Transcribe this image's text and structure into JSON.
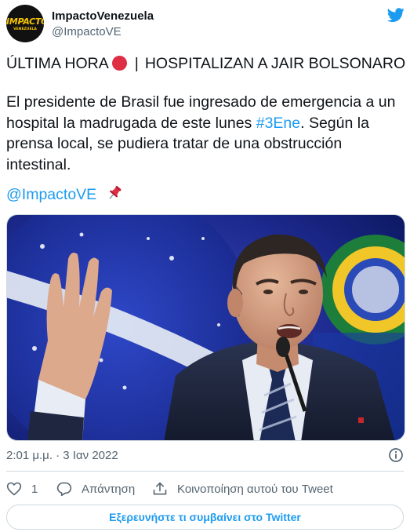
{
  "author": {
    "display_name": "ImpactoVenezuela",
    "handle": "@ImpactoVE",
    "avatar_logo_text": "IMPACTO",
    "avatar_logo_subtext": "VENEZUELA"
  },
  "tweet": {
    "headline_left": "ÚLTIMA HORA",
    "headline_separator": "|",
    "headline_right": "HOSPITALIZAN A JAIR BOLSONARO",
    "body_before_hashtag": "El presidente de Brasil fue ingresado de emergencia a un hospital la madrugada de este lunes ",
    "hashtag": "#3Ene",
    "body_after_hashtag": ". Según la prensa local, se pudiera tratar de una obstrucción intestinal.",
    "mention": "@ImpactoVE",
    "timestamp": "2:01 μ.μ. · 3 Ιαν 2022"
  },
  "actions": {
    "like_count": "1",
    "reply_label": "Απάντηση",
    "share_label": "Κοινοποίηση αυτού του Tweet"
  },
  "explore_button_label": "Εξερευνήστε τι συμβαίνει στο Twitter",
  "icons": [
    "twitter-bird-icon",
    "red-circle-emoji-icon",
    "pushpin-emoji-icon",
    "info-icon",
    "heart-icon",
    "reply-bubble-icon",
    "share-upload-icon"
  ],
  "colors": {
    "accent": "#1d9bf0",
    "text": "#0f1419",
    "secondary_text": "#536471",
    "border": "#cfd9de",
    "red_dot": "#dd2e44"
  }
}
